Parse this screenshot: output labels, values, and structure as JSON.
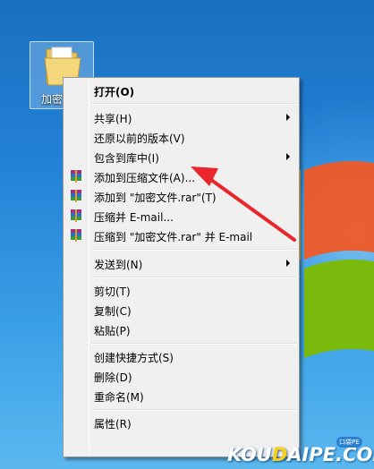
{
  "desktop": {
    "icon_label": "加密"
  },
  "menu": {
    "items": [
      {
        "label": "打开(O)",
        "bold": true,
        "submenu": false,
        "icon": null
      },
      {
        "label": "共享(H)",
        "submenu": true,
        "icon": null
      },
      {
        "label": "还原以前的版本(V)",
        "submenu": false,
        "icon": null
      },
      {
        "label": "包含到库中(I)",
        "submenu": true,
        "icon": null
      },
      {
        "label": "添加到压缩文件(A)...",
        "submenu": false,
        "icon": "winrar-icon"
      },
      {
        "label": "添加到 \"加密文件.rar\"(T)",
        "submenu": false,
        "icon": "winrar-icon"
      },
      {
        "label": "压缩并 E-mail...",
        "submenu": false,
        "icon": "winrar-icon"
      },
      {
        "label": "压缩到 \"加密文件.rar\" 并 E-mail",
        "submenu": false,
        "icon": "winrar-icon"
      },
      {
        "label": "发送到(N)",
        "submenu": true,
        "icon": null
      },
      {
        "label": "剪切(T)",
        "submenu": false,
        "icon": null
      },
      {
        "label": "复制(C)",
        "submenu": false,
        "icon": null
      },
      {
        "label": "粘贴(P)",
        "submenu": false,
        "icon": null
      },
      {
        "label": "创建快捷方式(S)",
        "submenu": false,
        "icon": null
      },
      {
        "label": "删除(D)",
        "submenu": false,
        "icon": null
      },
      {
        "label": "重命名(M)",
        "submenu": false,
        "icon": null
      },
      {
        "label": "属性(R)",
        "submenu": false,
        "icon": null
      }
    ]
  },
  "watermark": {
    "brand_a": "KOU",
    "brand_b": "D",
    "brand_c": "AIPE.COM",
    "badge": "口袋PE"
  },
  "colors": {
    "annotation_arrow": "#e8262b",
    "menu_bg": "#f0f0f0"
  }
}
